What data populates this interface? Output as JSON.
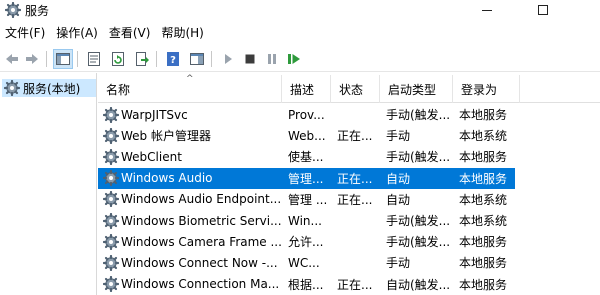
{
  "window": {
    "title": "服务"
  },
  "menu": [
    "文件(F)",
    "操作(A)",
    "查看(V)",
    "帮助(H)"
  ],
  "toolbar_icons": [
    "back-arrow-icon",
    "forward-arrow-icon",
    "show-hide-tree-icon",
    "properties-icon",
    "refresh-icon",
    "export-list-icon",
    "help-icon",
    "action-pane-icon",
    "start-service-icon",
    "stop-service-icon",
    "pause-service-icon",
    "restart-service-icon"
  ],
  "tree": {
    "root_label": "服务(本地)"
  },
  "columns": {
    "name": "名称",
    "desc": "描述",
    "status": "状态",
    "startup": "启动类型",
    "logon": "登录为"
  },
  "rows": [
    {
      "name": "WarpJITSvc",
      "desc": "Prov...",
      "status": "",
      "startup": "手动(触发...",
      "logon": "本地服务"
    },
    {
      "name": "Web 帐户管理器",
      "desc": "Web...",
      "status": "正在...",
      "startup": "手动",
      "logon": "本地系统"
    },
    {
      "name": "WebClient",
      "desc": "使基...",
      "status": "",
      "startup": "手动(触发...",
      "logon": "本地服务"
    },
    {
      "name": "Windows Audio",
      "desc": "管理...",
      "status": "正在...",
      "startup": "自动",
      "logon": "本地服务",
      "selected": true
    },
    {
      "name": "Windows Audio Endpoint...",
      "desc": "管理 ...",
      "status": "正在...",
      "startup": "自动",
      "logon": "本地系统"
    },
    {
      "name": "Windows Biometric Servi...",
      "desc": "Win...",
      "status": "",
      "startup": "手动(触发...",
      "logon": "本地系统"
    },
    {
      "name": "Windows Camera Frame ...",
      "desc": "允许...",
      "status": "",
      "startup": "手动(触发...",
      "logon": "本地服务"
    },
    {
      "name": "Windows Connect Now -...",
      "desc": "WC...",
      "status": "",
      "startup": "手动",
      "logon": "本地服务"
    },
    {
      "name": "Windows Connection Ma...",
      "desc": "根据...",
      "status": "正在...",
      "startup": "自动(触发...",
      "logon": "本地服务"
    }
  ],
  "colors": {
    "selection": "#0078d7",
    "tree_selection": "#cce8ff"
  }
}
